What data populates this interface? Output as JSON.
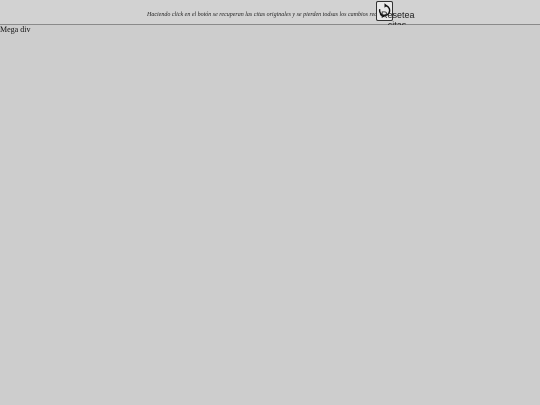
{
  "header": {
    "hint_text": "Haciendo click en el botón se recuperan las citas originales y se pierden todsas los cambios realizados.",
    "reset_button_label": "Resetea citas",
    "reset_icon": "refresh-icon"
  },
  "main": {
    "mega_div_label": "Mega div"
  }
}
